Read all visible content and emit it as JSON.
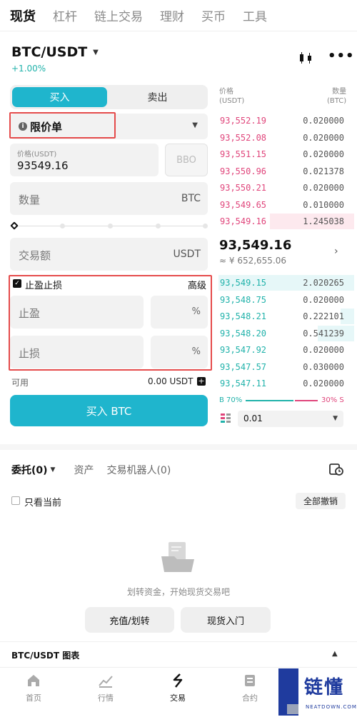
{
  "top_nav": [
    "现货",
    "杠杆",
    "链上交易",
    "理财",
    "买币",
    "工具"
  ],
  "pair": {
    "name": "BTC/USDT",
    "change": "+1.00%"
  },
  "trade_tabs": {
    "buy": "买入",
    "sell": "卖出"
  },
  "order_type": "限价单",
  "price": {
    "label": "价格(USDT)",
    "value": "93549.16",
    "bbo": "BBO"
  },
  "quantity": {
    "placeholder": "数量",
    "unit": "BTC"
  },
  "amount": {
    "placeholder": "交易额",
    "unit": "USDT"
  },
  "tpsl": {
    "label": "止盈止损",
    "advanced": "高级",
    "tp": "止盈",
    "sl": "止损",
    "pct": "%"
  },
  "available": {
    "label": "可用",
    "value": "0.00 USDT"
  },
  "buy_button": "买入 BTC",
  "orderbook": {
    "header_price": [
      "价格",
      "(USDT)"
    ],
    "header_qty": [
      "数量",
      "(BTC)"
    ],
    "asks": [
      {
        "price": "93,552.19",
        "qty": "0.020000",
        "depth": 0.0
      },
      {
        "price": "93,552.08",
        "qty": "0.020000",
        "depth": 0.0
      },
      {
        "price": "93,551.15",
        "qty": "0.020000",
        "depth": 0.0
      },
      {
        "price": "93,550.96",
        "qty": "0.021378",
        "depth": 0.0
      },
      {
        "price": "93,550.21",
        "qty": "0.020000",
        "depth": 0.0
      },
      {
        "price": "93,549.65",
        "qty": "0.010000",
        "depth": 0.0
      },
      {
        "price": "93,549.16",
        "qty": "1.245038",
        "depth": 0.62
      }
    ],
    "last_price": "93,549.16",
    "last_cny": "≈ ¥ 652,655.06",
    "bids": [
      {
        "price": "93,549.15",
        "qty": "2.020265",
        "depth": 1.0
      },
      {
        "price": "93,548.75",
        "qty": "0.020000",
        "depth": 0.0
      },
      {
        "price": "93,548.21",
        "qty": "0.222101",
        "depth": 0.1
      },
      {
        "price": "93,548.20",
        "qty": "0.541239",
        "depth": 0.27
      },
      {
        "price": "93,547.92",
        "qty": "0.020000",
        "depth": 0.0
      },
      {
        "price": "93,547.57",
        "qty": "0.030000",
        "depth": 0.0
      },
      {
        "price": "93,547.11",
        "qty": "0.020000",
        "depth": 0.0
      }
    ],
    "ratio_b": "B 70%",
    "ratio_s": "30% S",
    "buy_ratio": 0.7,
    "precision": "0.01"
  },
  "orders": {
    "tab1": "委托(0)",
    "tab2": "资产",
    "tab3": "交易机器人(0)",
    "only_current": "只看当前",
    "cancel_all": "全部撤销",
    "empty_text": "划转资金，开始现货交易吧",
    "deposit": "充值/划转",
    "intro": "现货入门"
  },
  "chart_bar": "BTC/USDT 图表",
  "bottom_nav": [
    "首页",
    "行情",
    "交易",
    "合约"
  ],
  "watermark": {
    "cn": "链懂",
    "en": "NEATDOWN.COM"
  },
  "colors": {
    "accent": "#1fb5cd",
    "ask": "#e0457b",
    "bid": "#20b2aa",
    "highlight_border": "#e54b4b"
  }
}
